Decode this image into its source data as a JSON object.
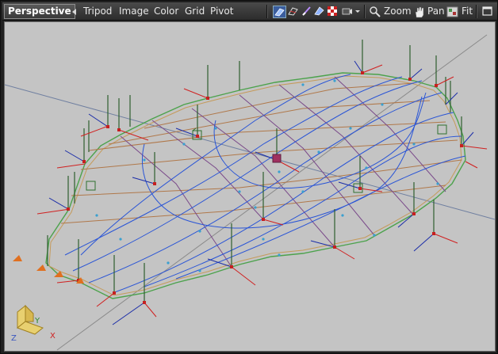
{
  "toolbar": {
    "view_name": "Perspective",
    "menus": [
      "Tripod",
      "Image",
      "Color",
      "Grid",
      "Pivot"
    ],
    "zoom_label": "Zoom",
    "pan_label": "Pan",
    "fit_label": "Fit"
  },
  "icons": {
    "prev": "triangle-left-icon",
    "shaded": "shaded-mode-icon",
    "wire": "wireframe-mode-icon",
    "brush": "brush-icon",
    "texture": "texture-icon",
    "checker": "checker-icon",
    "camera": "camera-icon",
    "dropdown": "chevron-down-icon",
    "zoom": "magnifier-icon",
    "pan": "hand-icon",
    "fit": "fit-icon",
    "maximize": "maximize-icon"
  },
  "viewport": {
    "background": "#c4c4c4",
    "axis_labels": {
      "x": "X",
      "y": "Y",
      "z": "Z"
    }
  }
}
